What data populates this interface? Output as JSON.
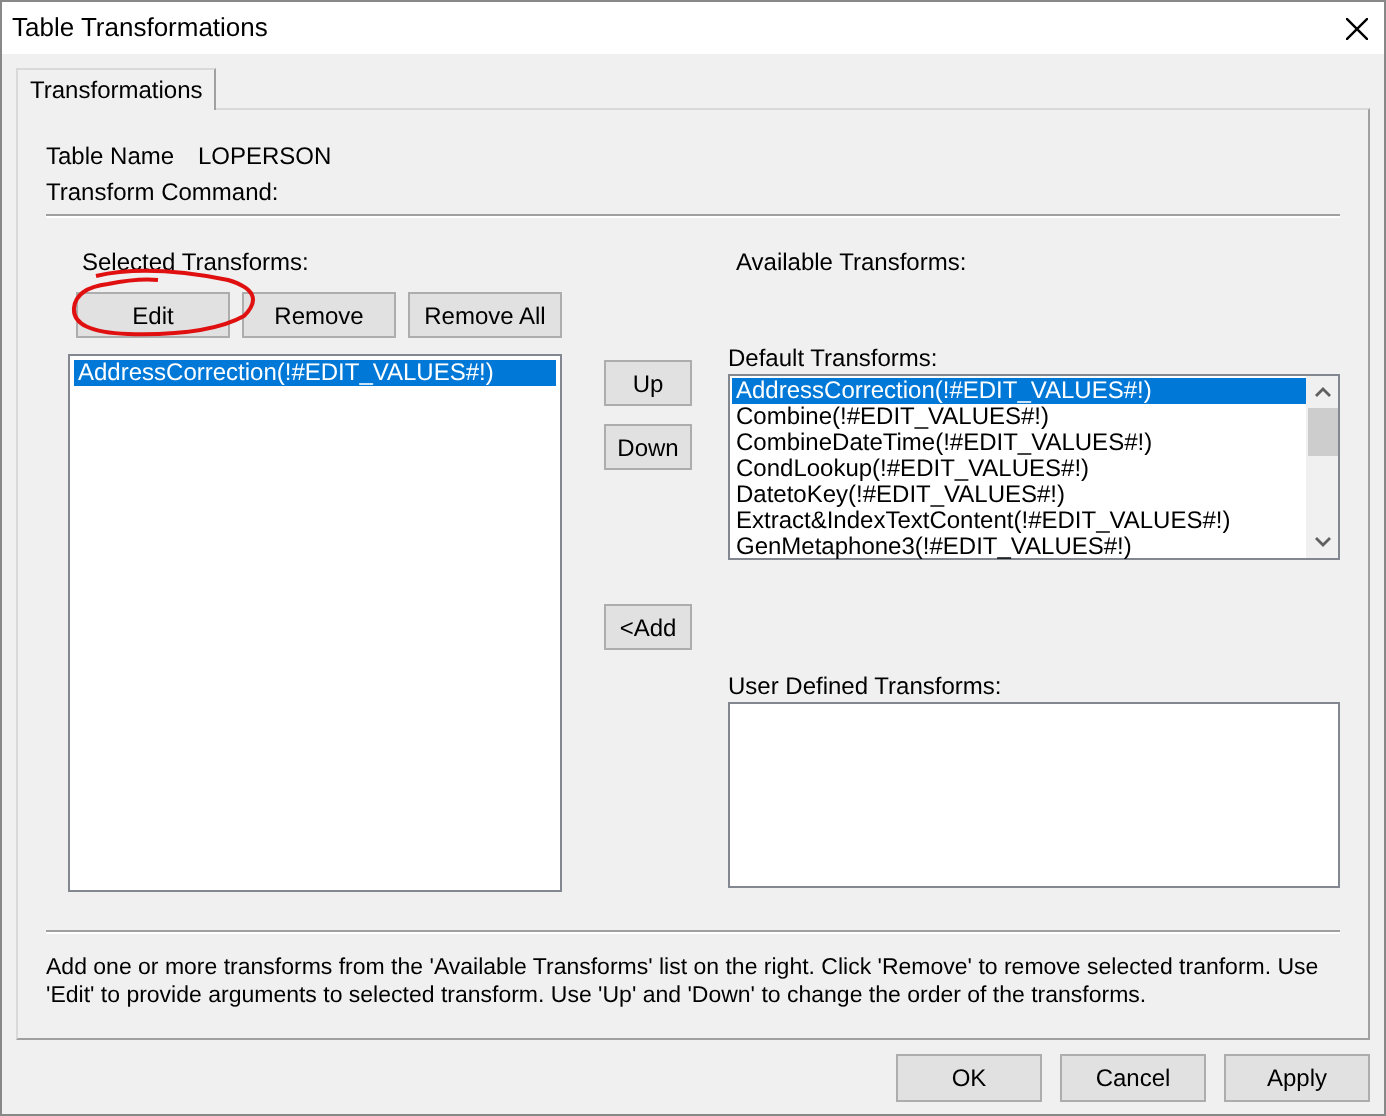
{
  "window": {
    "title": "Table Transformations"
  },
  "tabs": [
    {
      "label": "Transformations",
      "selected": true
    }
  ],
  "table_name": {
    "label": "Table Name",
    "value": "LOPERSON"
  },
  "transform_command": {
    "label": "Transform Command:"
  },
  "selected_transforms": {
    "label": "Selected Transforms:",
    "buttons": [
      "Edit",
      "Remove",
      "Remove All"
    ],
    "items": [
      {
        "label": "AddressCorrection(!#EDIT_VALUES#!)",
        "selected": true
      }
    ]
  },
  "move_buttons": [
    "Up",
    "Down",
    "<Add"
  ],
  "available_transforms": {
    "label": "Available Transforms:",
    "default": {
      "label": "Default Transforms:",
      "items": [
        {
          "label": "AddressCorrection(!#EDIT_VALUES#!)",
          "selected": true
        },
        {
          "label": "Combine(!#EDIT_VALUES#!)",
          "selected": false
        },
        {
          "label": "CombineDateTime(!#EDIT_VALUES#!)",
          "selected": false
        },
        {
          "label": "CondLookup(!#EDIT_VALUES#!)",
          "selected": false
        },
        {
          "label": "DatetoKey(!#EDIT_VALUES#!)",
          "selected": false
        },
        {
          "label": "Extract&IndexTextContent(!#EDIT_VALUES#!)",
          "selected": false
        },
        {
          "label": "GenMetaphone3(!#EDIT_VALUES#!)",
          "selected": false
        }
      ]
    },
    "user_defined": {
      "label": "User Defined Transforms:"
    }
  },
  "help_text": "Add one or more transforms from the 'Available Transforms' list on the right. Click 'Remove' to remove selected tranform. Use 'Edit' to provide arguments to selected transform. Use 'Up' and 'Down' to change the order of the transforms.",
  "footer_buttons": [
    "OK",
    "Cancel",
    "Apply"
  ]
}
